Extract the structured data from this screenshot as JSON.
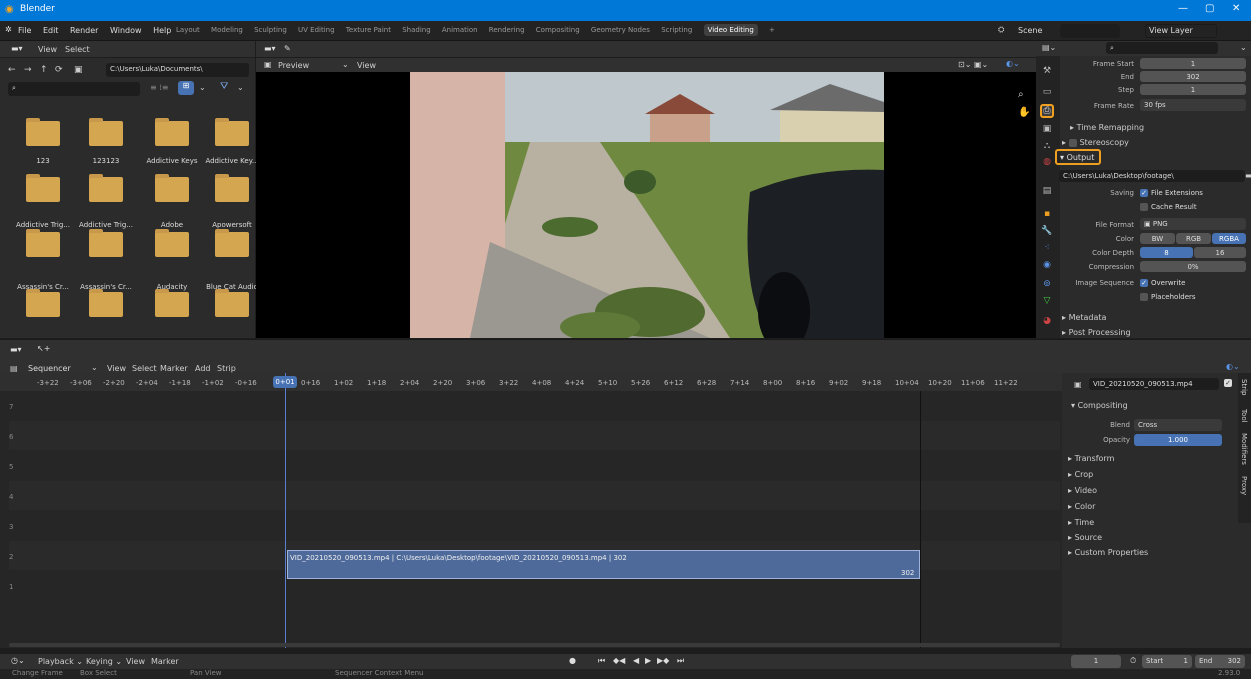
{
  "window": {
    "title": "Blender",
    "min": "—",
    "max": "▢",
    "close": "✕"
  },
  "menu": [
    "File",
    "Edit",
    "Render",
    "Window",
    "Help"
  ],
  "workspaces": [
    "Layout",
    "Modeling",
    "Sculpting",
    "UV Editing",
    "Texture Paint",
    "Shading",
    "Animation",
    "Rendering",
    "Compositing",
    "Geometry Nodes",
    "Scripting",
    "Video Editing"
  ],
  "add_workspace": "+",
  "scene": "Scene",
  "view_layer": "View Layer",
  "file_browser": {
    "menu": [
      "View",
      "Select"
    ],
    "path": "C:\\Users\\Luka\\Documents\\",
    "folders": [
      "123",
      "123123",
      "Addictive Keys",
      "Addictive Key...",
      "Addictive Trig...",
      "Addictive Trig...",
      "Adobe",
      "Apowersoft",
      "Assassin's Cr...",
      "Assassin's Cr...",
      "Audacity",
      "Blue Cat Audio",
      "",
      "",
      "",
      ""
    ]
  },
  "preview": {
    "mode": "Preview",
    "view": "View"
  },
  "properties": {
    "frame_start_label": "Frame Start",
    "frame_start": "1",
    "end_label": "End",
    "end": "302",
    "step_label": "Step",
    "step": "1",
    "frame_rate_label": "Frame Rate",
    "frame_rate": "30 fps",
    "time_remapping": "Time Remapping",
    "stereoscopy": "Stereoscopy",
    "output": "Output",
    "output_path": "C:\\Users\\Luka\\Desktop\\footage\\",
    "saving_label": "Saving",
    "file_extensions": "File Extensions",
    "cache_result": "Cache Result",
    "file_format_label": "File Format",
    "file_format": "PNG",
    "color_label": "Color",
    "color_opts": [
      "BW",
      "RGB",
      "RGBA"
    ],
    "color_depth_label": "Color Depth",
    "depth_opts": [
      "8",
      "16"
    ],
    "compression_label": "Compression",
    "compression": "0%",
    "image_sequence_label": "Image Sequence",
    "overwrite": "Overwrite",
    "placeholders": "Placeholders",
    "metadata": "Metadata",
    "post_processing": "Post Processing"
  },
  "sequencer": {
    "editor": "Sequencer",
    "menu": [
      "View",
      "Select",
      "Marker",
      "Add",
      "Strip"
    ],
    "ticks": [
      "-3+22",
      "-3+06",
      "-2+20",
      "-2+04",
      "-1+18",
      "-1+02",
      "-0+16",
      "0+01",
      "0+16",
      "1+02",
      "1+18",
      "2+04",
      "2+20",
      "3+06",
      "3+22",
      "4+08",
      "4+24",
      "5+10",
      "5+26",
      "6+12",
      "6+28",
      "7+14",
      "8+00",
      "8+16",
      "9+02",
      "9+18",
      "10+04",
      "10+20",
      "11+06",
      "11+22"
    ],
    "rows": [
      "7",
      "6",
      "5",
      "4",
      "3",
      "2",
      "1"
    ],
    "strip_label": "VID_20210520_090513.mp4 | C:\\Users\\Luka\\Desktop\\footage\\VID_20210520_090513.mp4 | 302",
    "strip_end": "302"
  },
  "strip_panel": {
    "name": "VID_20210520_090513.mp4",
    "compositing": "Compositing",
    "blend_label": "Blend",
    "blend": "Cross",
    "opacity_label": "Opacity",
    "opacity": "1.000",
    "sections": [
      "Transform",
      "Crop",
      "Video",
      "Color",
      "Time",
      "Source",
      "Custom Properties"
    ],
    "tabs": [
      "Strip",
      "Tool",
      "Modifiers",
      "Proxy"
    ]
  },
  "timeline": {
    "menu": [
      "Playback",
      "Keying",
      "View",
      "Marker"
    ],
    "current": "1",
    "start_label": "Start",
    "start": "1",
    "end_label": "End",
    "end": "302"
  },
  "status": {
    "items": [
      "Change Frame",
      "Box Select",
      "Pan View",
      "Sequencer Context Menu"
    ],
    "version": "2.93.0"
  }
}
